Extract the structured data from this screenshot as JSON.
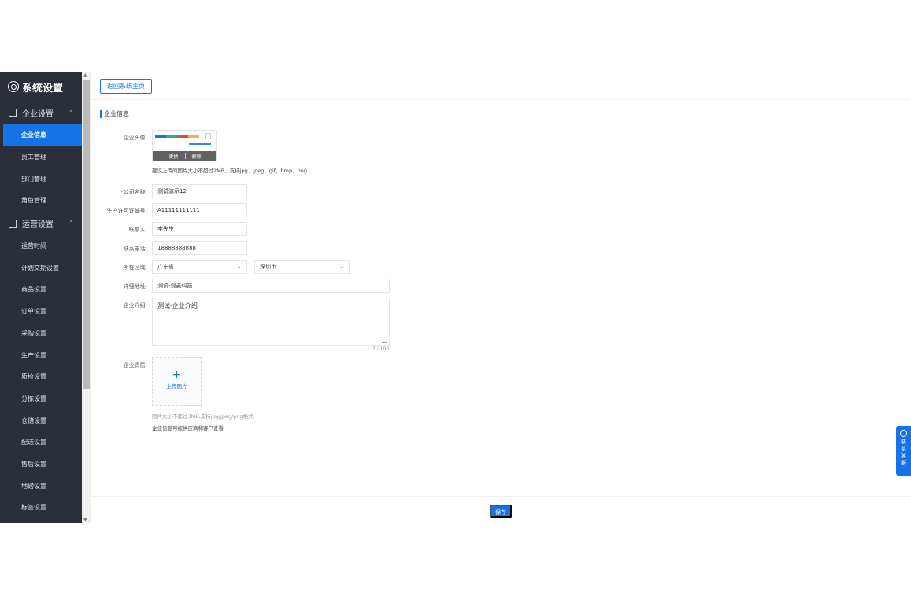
{
  "sidebar": {
    "title": "系统设置",
    "groups": [
      {
        "label": "企业设置",
        "items": [
          "企业信息",
          "员工管理",
          "部门管理",
          "角色管理"
        ],
        "active": "企业信息"
      },
      {
        "label": "运营设置",
        "items": [
          "运营时间",
          "计划交期设置",
          "商品设置",
          "订单设置",
          "采购设置",
          "生产设置",
          "质检设置",
          "分拣设置",
          "仓储设置",
          "配送设置",
          "售后设置",
          "地磅设置",
          "标签设置"
        ]
      }
    ]
  },
  "topbar": {
    "back_label": "返回系统主页"
  },
  "section": {
    "title": "企业信息"
  },
  "form": {
    "avatar_label": "企业头像:",
    "avatar_change": "更换",
    "avatar_delete": "删除",
    "avatar_hint": "建议上传的图片大小不超过2MB，支持jpg、jpeg、gif、bmp、png",
    "company_name_label": "公司名称:",
    "company_name_required": "*",
    "company_name": "测试演示12",
    "license_label": "生产许可证编号:",
    "license": "A11111111111",
    "contact_label": "联系人:",
    "contact": "李先生",
    "phone_label": "联系电话:",
    "phone": "18888888888",
    "region_label": "所在区域:",
    "province": "广东省",
    "city": "深圳市",
    "address_label": "详细地址:",
    "address": "测试-观麦科技",
    "intro_label": "企业介绍:",
    "intro": "测试-企业介绍",
    "intro_counter": "7 / 100",
    "qualification_label": "企业资质:",
    "upload_label": "上传图片",
    "upload_hint": "图片大小不超过3MB,支持jpg/jpeg/png格式",
    "visibility_note": "企业信息可被供应商和客户查看"
  },
  "footer": {
    "save_label": "保存"
  },
  "service": {
    "label_lines": [
      "联",
      "系",
      "客",
      "服"
    ]
  },
  "colors": {
    "accent": "#1473e6",
    "sidebar_bg": "#2b2f3a",
    "required": "#e0332b"
  }
}
